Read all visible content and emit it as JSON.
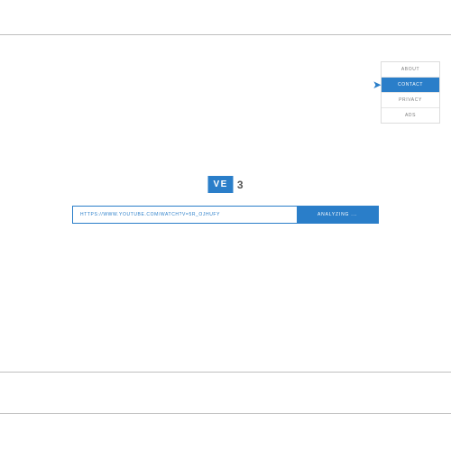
{
  "menu": {
    "items": [
      {
        "label": "About"
      },
      {
        "label": "Contact"
      },
      {
        "label": "Privacy"
      },
      {
        "label": "Ads"
      }
    ],
    "active_index": 1
  },
  "logo": {
    "badge": "VE",
    "suffix": "3"
  },
  "search": {
    "value": "https://www.youtube.com/watch?v=5r_OJHUFY",
    "button_label": "Analyzing ..."
  }
}
